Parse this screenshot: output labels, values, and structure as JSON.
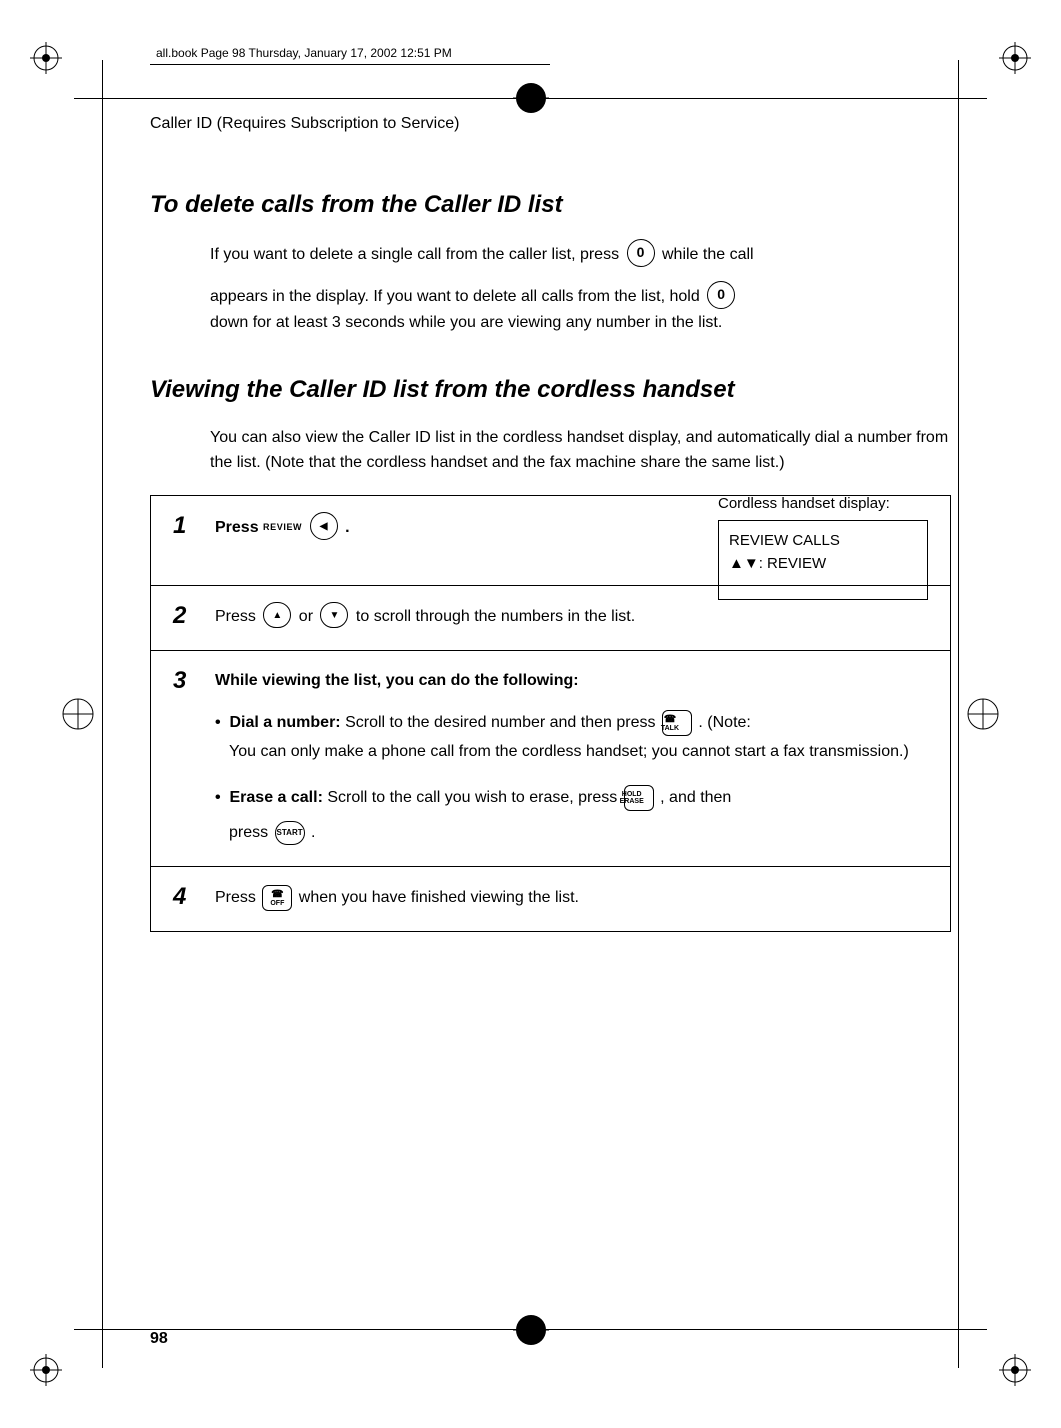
{
  "file_header": "all.book  Page 98  Thursday, January 17, 2002  12:51 PM",
  "running_head": "Caller ID (Requires Subscription to Service)",
  "section1_title": "To delete calls from the Caller ID list",
  "section1_para1a": "If you want to delete a single call from the caller list, press ",
  "section1_para1b": " while the call",
  "section1_para2a": "appears in the display. If you want to delete all calls from the list, hold ",
  "section1_para2b": "down for at least 3 seconds while you are viewing any number in the list.",
  "key_zero": "0",
  "section2_title": "Viewing the Caller ID list from the cordless handset",
  "section2_para": "You can also view the Caller ID list in the cordless handset display, and automatically dial a number from the list. (Note that the cordless handset and the fax machine share the same list.)",
  "steps": {
    "s1": {
      "num": "1",
      "press": "Press ",
      "review_label": "REVIEW",
      "period": " .",
      "display_caption": "Cordless handset display:",
      "display_line1": "REVIEW CALLS",
      "display_line2": "▲▼: REVIEW"
    },
    "s2": {
      "num": "2",
      "a": "Press ",
      "b": " or ",
      "c": " to scroll through the numbers in the list."
    },
    "s3": {
      "num": "3",
      "head": "While viewing the list, you can do the following:",
      "dial_a": "Dial a number:",
      "dial_b": " Scroll to the desired number and then press ",
      "dial_c": " . (Note:",
      "dial_d": "You can only make a phone call from the cordless handset; you cannot start a fax transmission.)",
      "erase_a": "Erase a call:",
      "erase_b": " Scroll to the call you wish to erase, press ",
      "erase_c": " , and then",
      "erase_d": "press ",
      "erase_e": " .",
      "talk_key": "TALK",
      "hold_key_top": "HOLD",
      "hold_key_bot": "ERASE",
      "start_key": "START"
    },
    "s4": {
      "num": "4",
      "a": "Press ",
      "b": " when you have finished viewing the list.",
      "off_key": "OFF"
    }
  },
  "page_number": "98"
}
